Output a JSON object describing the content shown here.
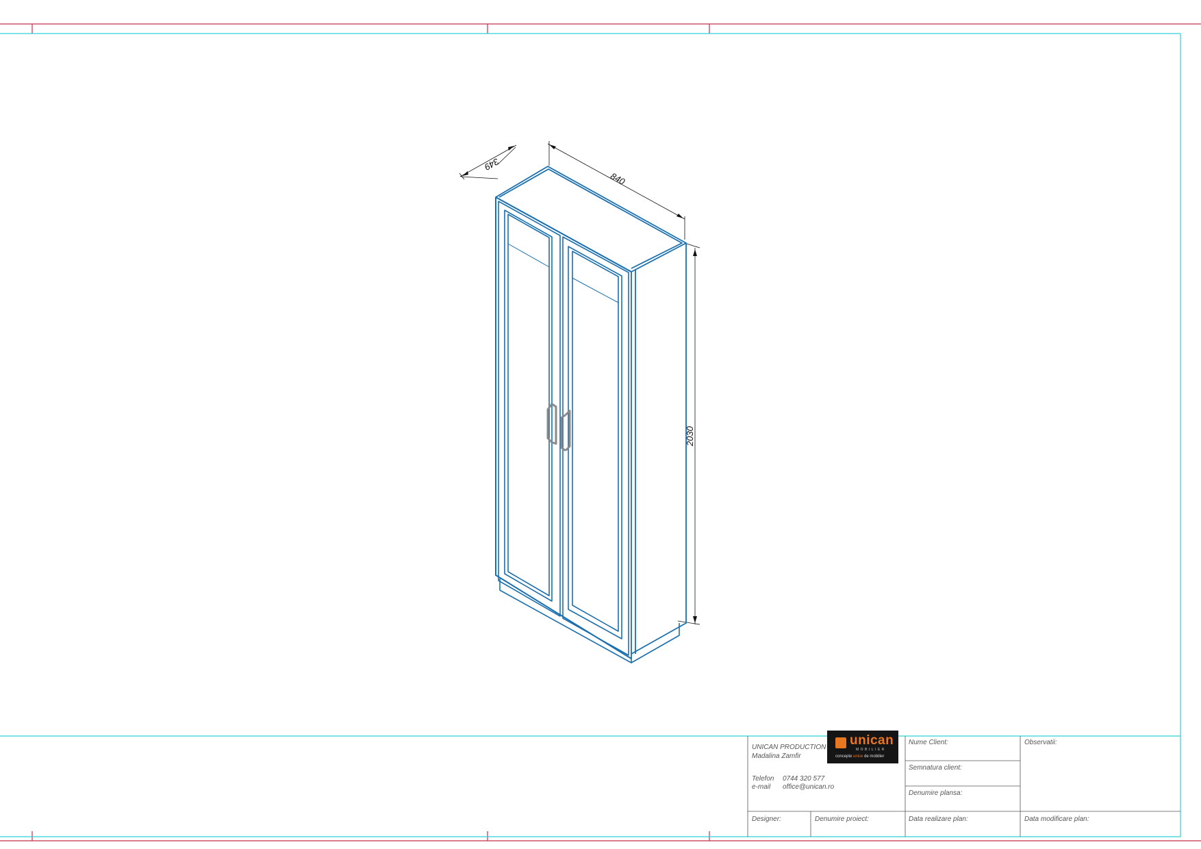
{
  "drawing": {
    "dimensions": {
      "depth": "349",
      "width": "840",
      "height": "2030"
    }
  },
  "title_block": {
    "company": "UNICAN PRODUCTION",
    "person": "Madalina Zamfir",
    "phone_label": "Telefon",
    "phone": "0744 320 577",
    "email_label": "e-mail",
    "email": "office@unican.ro",
    "logo": {
      "name": "unican",
      "sub": "MOBILIER",
      "tagline_pre": "concepte ",
      "tagline_accent": "unice",
      "tagline_post": " de mobilier"
    },
    "client_name": "Nume Client:",
    "client_signature": "Semnatura client:",
    "sheet_name": "Denumire plansa:",
    "observations": "Observatii:",
    "designer": "Designer:",
    "project_name": "Denumire proiect:",
    "plan_date": "Data realizare plan:",
    "plan_modified": "Data modificare plan:"
  },
  "colors": {
    "frame": "#c0304a",
    "inner_frame": "#2fd0d8",
    "cabinet": "#1a6fae",
    "handle": "#8a8a8a"
  }
}
